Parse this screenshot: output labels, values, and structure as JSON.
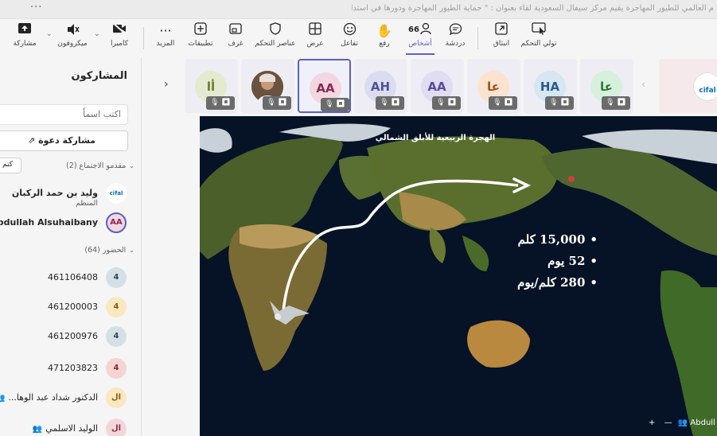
{
  "window": {
    "more_dots": "···",
    "title": "م العالمي للطيور المهاجرة يقيم مركز سيفال السعودية لقاء بعنوان : \" حماية الطيور المهاجرة ودورها في استدامة النظ..."
  },
  "toolbar": {
    "people_count": "66",
    "items": [
      {
        "name": "share",
        "label": "مشاركة",
        "icon": "share-icon"
      },
      {
        "name": "mic",
        "label": "ميكروفون",
        "icon": "mic-off-icon"
      },
      {
        "name": "camera",
        "label": "كاميرا",
        "icon": "camera-off-icon"
      },
      {
        "name": "more",
        "label": "المزيد",
        "icon": "more-icon"
      },
      {
        "name": "apps",
        "label": "تطبيقات",
        "icon": "apps-icon"
      },
      {
        "name": "rooms",
        "label": "غرف",
        "icon": "rooms-icon"
      },
      {
        "name": "controls",
        "label": "عناصر التحكم",
        "icon": "shield-icon"
      },
      {
        "name": "view",
        "label": "عرض",
        "icon": "grid-icon"
      },
      {
        "name": "react",
        "label": "تفاعل",
        "icon": "smile-icon"
      },
      {
        "name": "raise",
        "label": "رفع",
        "icon": "hand-icon"
      },
      {
        "name": "people",
        "label": "أشخاص",
        "icon": "people-icon"
      },
      {
        "name": "chat",
        "label": "دردشة",
        "icon": "chat-icon"
      },
      {
        "name": "popout",
        "label": "انبثاق",
        "icon": "popout-icon"
      },
      {
        "name": "take-control",
        "label": "تولي التحكم",
        "icon": "take-control-icon"
      }
    ]
  },
  "participants_panel": {
    "title": "المشاركون",
    "search_placeholder": "اكتب اسماً",
    "invite_label": "مشاركة دعوة",
    "presenters_header": "مقدمو الاجتماع (2)",
    "mute_all": "كتم",
    "attendees_header": "الحضور (64)",
    "presenters": [
      {
        "name": "وليد بن حمد الركبان",
        "role": "المنظم",
        "avatar": "cifal"
      },
      {
        "name": "Abdullah Alsuhaibany",
        "avatar": "AA"
      }
    ],
    "attendees": [
      {
        "name": "461106408",
        "avatar": "4"
      },
      {
        "name": "461200003",
        "avatar": "4"
      },
      {
        "name": "461200976",
        "avatar": "4"
      },
      {
        "name": "471203823",
        "avatar": "4"
      },
      {
        "name": "الدكتور شداد عبد الوها...",
        "avatar": "ال"
      },
      {
        "name": "الوليد الاسلمي",
        "avatar": "ال"
      }
    ]
  },
  "video_strip": {
    "tiles": [
      {
        "initials": "أا",
        "color": "#e3eacf",
        "text_color": "#6b7a2a"
      },
      {
        "initials": "photo",
        "color": "#5a4a3a",
        "text_color": "#fff"
      },
      {
        "initials": "AA",
        "color": "#f2d6e0",
        "text_color": "#8a2850"
      },
      {
        "initials": "AH",
        "color": "#dcdcf0",
        "text_color": "#4f4f9a"
      },
      {
        "initials": "AA",
        "color": "#e0dcf2",
        "text_color": "#5a4a9a"
      },
      {
        "initials": "عا",
        "color": "#fbe3cf",
        "text_color": "#a0541a"
      },
      {
        "initials": "HA",
        "color": "#d6e6f2",
        "text_color": "#2a5a8a"
      },
      {
        "initials": "عا",
        "color": "#d6f0dc",
        "text_color": "#2a7a3a"
      }
    ],
    "cifal_label": "cifal"
  },
  "shared_content": {
    "title": "الهجرة الربيعية للأبلق الشمالي",
    "stats": [
      "15,000 كلم",
      "52 يوم",
      "280 كلم/يوم"
    ],
    "bottom_name": "Abdull"
  }
}
